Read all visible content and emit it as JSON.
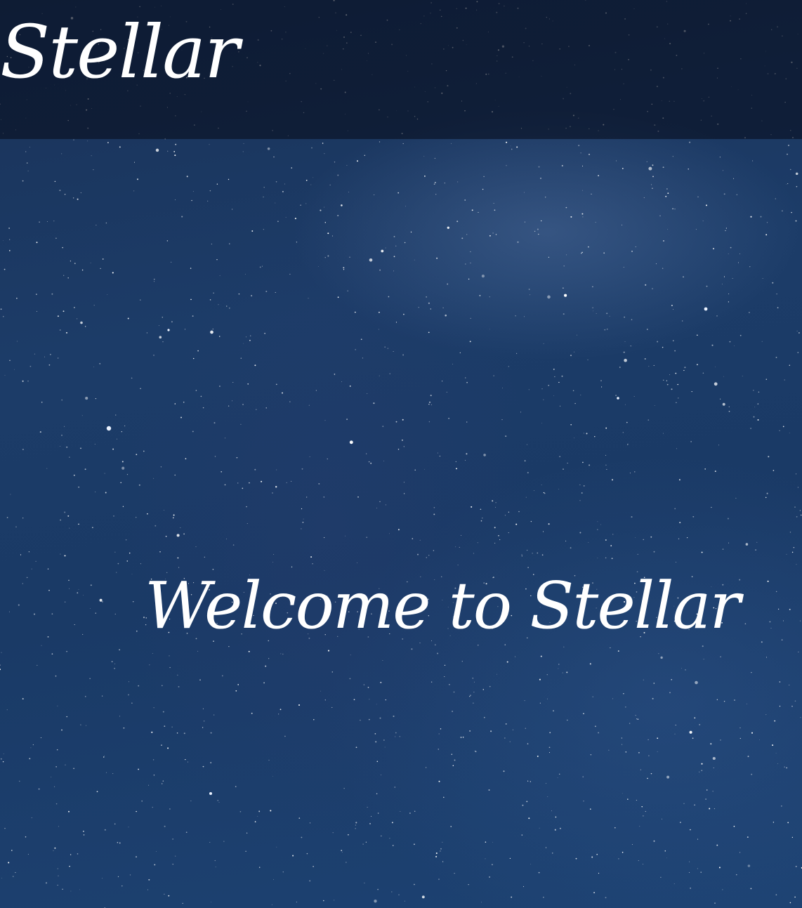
{
  "header": {
    "brand": "Stellar"
  },
  "hero": {
    "title": "Welcome to Stellar"
  },
  "background": {
    "image": "night-sky-stars"
  },
  "colors": {
    "header_overlay": "#0a1020",
    "sky_deep": "#1a3258",
    "sky_mid": "#1d4272",
    "text": "#ffffff"
  }
}
